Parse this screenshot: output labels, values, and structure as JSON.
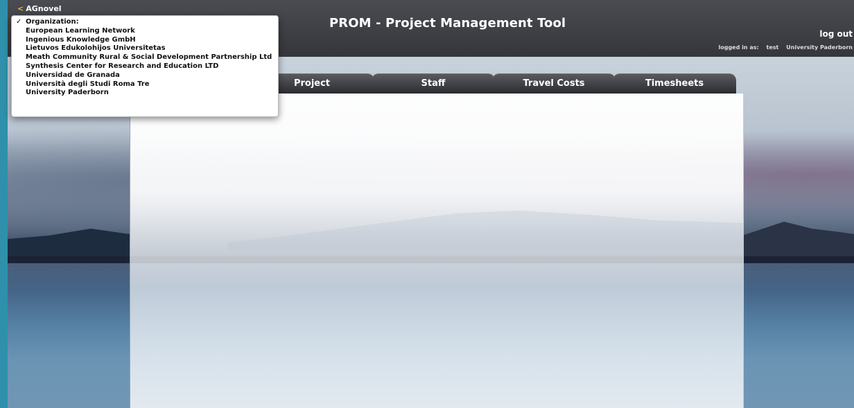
{
  "header": {
    "back_label": "AGnovel",
    "back_chevron": "<",
    "title": "PROM - Project Management Tool",
    "logout": "log out",
    "logged_in_label": "logged in as:",
    "username": "test",
    "organization": "University Paderborn"
  },
  "tabs": [
    {
      "label": "Project"
    },
    {
      "label": "Staff"
    },
    {
      "label": "Travel Costs"
    },
    {
      "label": "Timesheets"
    }
  ],
  "dropdown": {
    "selected_mark": "✓",
    "items": [
      {
        "label": "Organization:",
        "checked": true
      },
      {
        "label": "European Learning Network"
      },
      {
        "label": "Ingenious Knowledge GmbH"
      },
      {
        "label": "Lietuvos Edukolohijos Universitetas"
      },
      {
        "label": "Meath Community Rural & Social Development Partnership Ltd"
      },
      {
        "label": "Synthesis Center for Research and Education LTD"
      },
      {
        "label": "Universidad de Granada"
      },
      {
        "label": "Università degli Studi Roma Tre"
      },
      {
        "label": "University Paderborn"
      }
    ]
  },
  "colors": {
    "accent_chevron": "#f2b12a",
    "header_bg": "#3a3c42",
    "tab_bg": "#2b2c30",
    "left_strip": "#2f90ab"
  }
}
